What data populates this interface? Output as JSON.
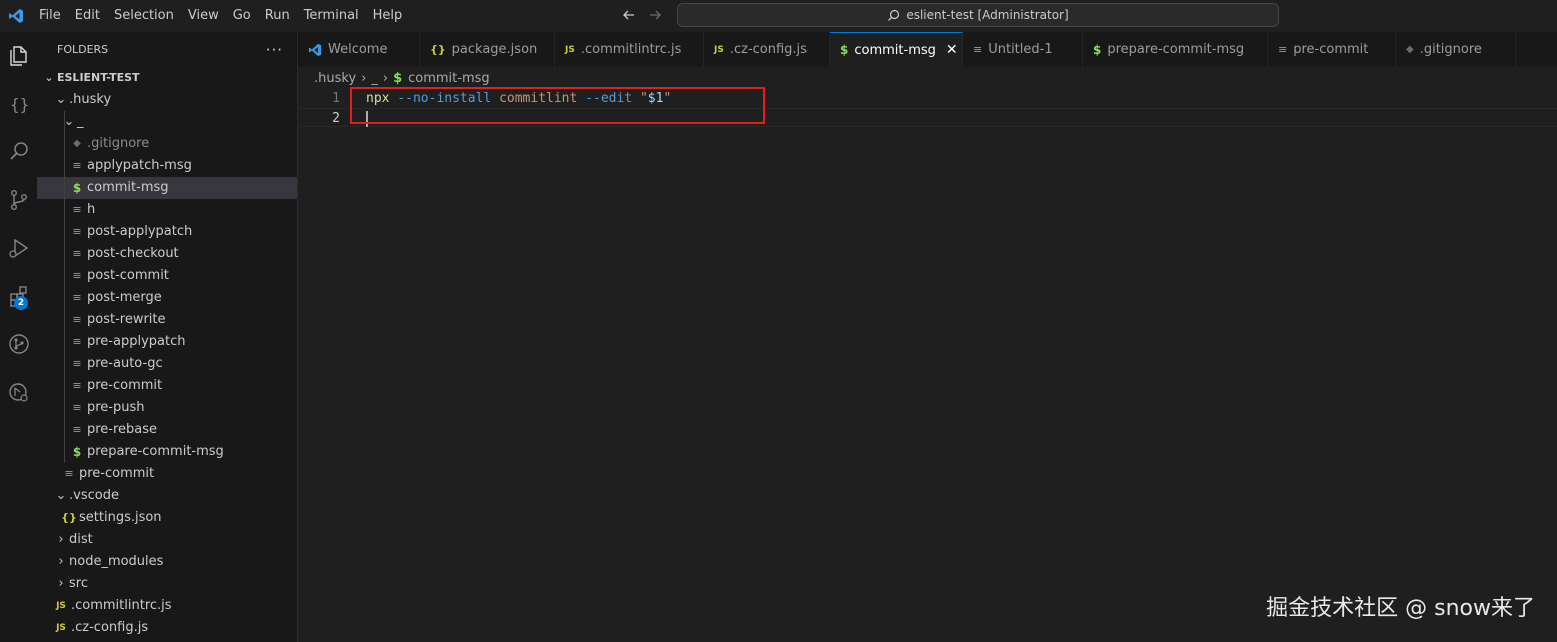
{
  "titlebar": {
    "menu": [
      "File",
      "Edit",
      "Selection",
      "View",
      "Go",
      "Run",
      "Terminal",
      "Help"
    ],
    "search_text": "eslient-test [Administrator]"
  },
  "activitybar": {
    "icons": [
      "explorer-icon",
      "json-icon",
      "search-icon",
      "source-control-icon",
      "run-debug-icon",
      "extensions-icon",
      "git-graph-icon",
      "remote-icon"
    ],
    "extensions_badge": "2"
  },
  "sidebar": {
    "header": "FOLDERS",
    "more": "···",
    "root": "ESLIENT-TEST",
    "items": [
      {
        "label": ".husky",
        "icon": "chevron-down"
      },
      {
        "label": "_",
        "icon": "chevron-down"
      },
      {
        "label": ".gitignore",
        "icon": "git"
      },
      {
        "label": "applypatch-msg",
        "icon": "lines"
      },
      {
        "label": "commit-msg",
        "icon": "shell"
      },
      {
        "label": "h",
        "icon": "lines"
      },
      {
        "label": "post-applypatch",
        "icon": "lines"
      },
      {
        "label": "post-checkout",
        "icon": "lines"
      },
      {
        "label": "post-commit",
        "icon": "lines"
      },
      {
        "label": "post-merge",
        "icon": "lines"
      },
      {
        "label": "post-rewrite",
        "icon": "lines"
      },
      {
        "label": "pre-applypatch",
        "icon": "lines"
      },
      {
        "label": "pre-auto-gc",
        "icon": "lines"
      },
      {
        "label": "pre-commit",
        "icon": "lines"
      },
      {
        "label": "pre-push",
        "icon": "lines"
      },
      {
        "label": "pre-rebase",
        "icon": "lines"
      },
      {
        "label": "prepare-commit-msg",
        "icon": "shell"
      },
      {
        "label": "pre-commit",
        "icon": "lines"
      },
      {
        "label": ".vscode",
        "icon": "chevron-down"
      },
      {
        "label": "settings.json",
        "icon": "json"
      },
      {
        "label": "dist",
        "icon": "chevron-right"
      },
      {
        "label": "node_modules",
        "icon": "chevron-right"
      },
      {
        "label": "src",
        "icon": "chevron-right"
      },
      {
        "label": ".commitlintrc.js",
        "icon": "js"
      },
      {
        "label": ".cz-config.js",
        "icon": "js"
      }
    ]
  },
  "tabs": [
    {
      "label": "Welcome",
      "icon": "vscode"
    },
    {
      "label": "package.json",
      "icon": "json"
    },
    {
      "label": ".commitlintrc.js",
      "icon": "js"
    },
    {
      "label": ".cz-config.js",
      "icon": "js"
    },
    {
      "label": "commit-msg",
      "icon": "shell",
      "active": true
    },
    {
      "label": "Untitled-1",
      "icon": "lines"
    },
    {
      "label": "prepare-commit-msg",
      "icon": "shell"
    },
    {
      "label": "pre-commit",
      "icon": "lines"
    },
    {
      "label": ".gitignore",
      "icon": "git"
    }
  ],
  "icon_glyphs": {
    "json": "{}",
    "js": "JS",
    "shell": "$",
    "lines": "≡",
    "git": "◆",
    "close": "✕"
  },
  "breadcrumb": {
    "parts": [
      ".husky",
      "_"
    ],
    "file": "commit-msg"
  },
  "editor": {
    "line_numbers": [
      "1",
      "2"
    ],
    "line1": {
      "cmd": "npx",
      "flag1": "--no-install",
      "word": "commitlint",
      "flag2": "--edit",
      "q1": "\"",
      "var": "$1",
      "q2": "\""
    }
  },
  "watermark": "掘金技术社区 @ snow来了",
  "colors": {
    "accent": "#0078d4",
    "highlight_box": "#e0201f",
    "shell_icon": "#89e051",
    "js_icon": "#cbcb41"
  }
}
